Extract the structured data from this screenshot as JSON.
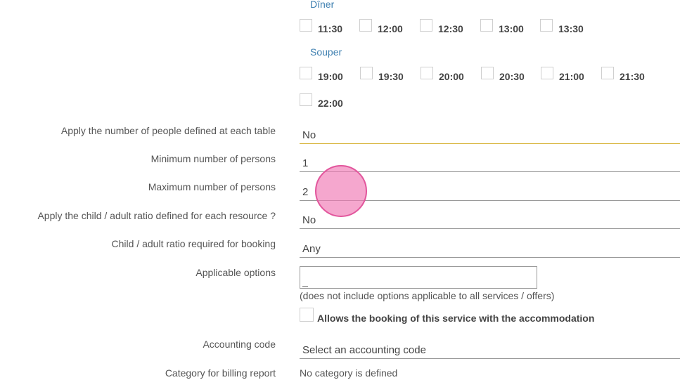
{
  "sections": {
    "diner": {
      "title": "Dîner",
      "slots": [
        "11:30",
        "12:00",
        "12:30",
        "13:00",
        "13:30"
      ]
    },
    "souper": {
      "title": "Souper",
      "slots": [
        "19:00",
        "19:30",
        "20:00",
        "20:30",
        "21:00",
        "21:30",
        "22:00"
      ]
    }
  },
  "form": {
    "apply_people_table": {
      "label": "Apply the number of people defined at each table",
      "value": "No"
    },
    "min_persons": {
      "label": "Minimum number of persons",
      "value": "1"
    },
    "max_persons": {
      "label": "Maximum number of persons",
      "value": "2"
    },
    "apply_child_ratio": {
      "label": "Apply the child / adult ratio defined for each resource ?",
      "value": "No"
    },
    "child_ratio": {
      "label": "Child / adult ratio required for booking",
      "value": "Any"
    },
    "options": {
      "label": "Applicable options",
      "hint": "(does not include options applicable to all services / offers)"
    },
    "allow_accommodation": {
      "label": "Allows the booking of this service with the accommodation"
    },
    "accounting_code": {
      "label": "Accounting code",
      "placeholder": "Select an accounting code"
    },
    "billing_category": {
      "label": "Category for billing report",
      "value": "No category is defined"
    }
  }
}
